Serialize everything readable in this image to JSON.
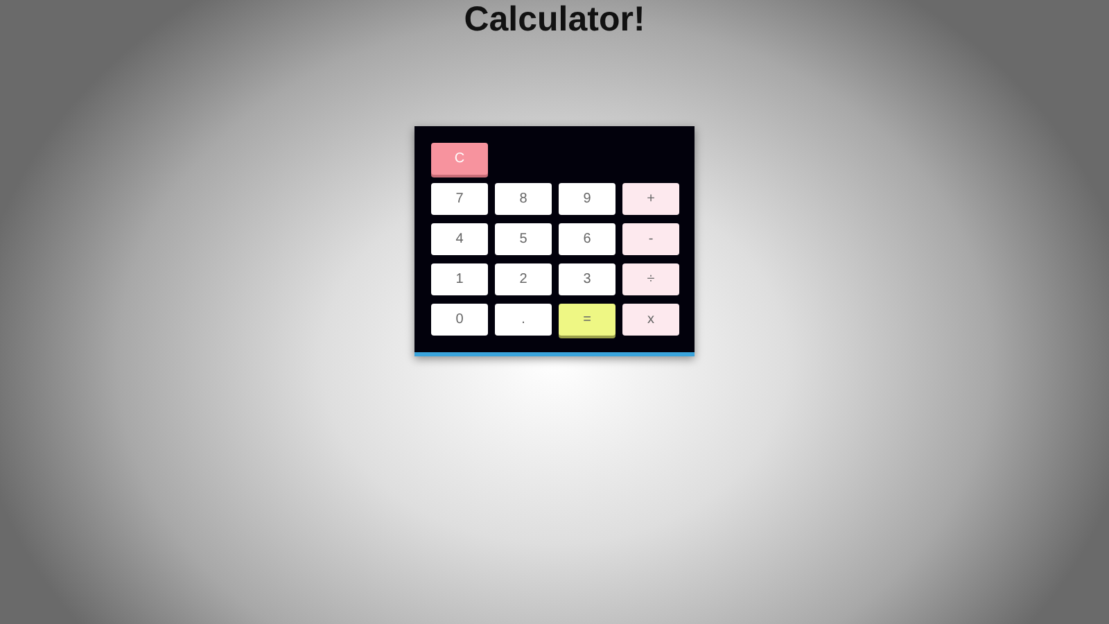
{
  "title": "Calculator!",
  "keys": [
    {
      "label": "C",
      "kind": "clear"
    },
    {
      "label": "7",
      "kind": "digit"
    },
    {
      "label": "8",
      "kind": "digit"
    },
    {
      "label": "9",
      "kind": "digit"
    },
    {
      "label": "+",
      "kind": "operator"
    },
    {
      "label": "4",
      "kind": "digit"
    },
    {
      "label": "5",
      "kind": "digit"
    },
    {
      "label": "6",
      "kind": "digit"
    },
    {
      "label": "-",
      "kind": "operator"
    },
    {
      "label": "1",
      "kind": "digit"
    },
    {
      "label": "2",
      "kind": "digit"
    },
    {
      "label": "3",
      "kind": "digit"
    },
    {
      "label": "÷",
      "kind": "operator"
    },
    {
      "label": "0",
      "kind": "digit"
    },
    {
      "label": ".",
      "kind": "digit"
    },
    {
      "label": "=",
      "kind": "equals"
    },
    {
      "label": "x",
      "kind": "operator"
    }
  ]
}
